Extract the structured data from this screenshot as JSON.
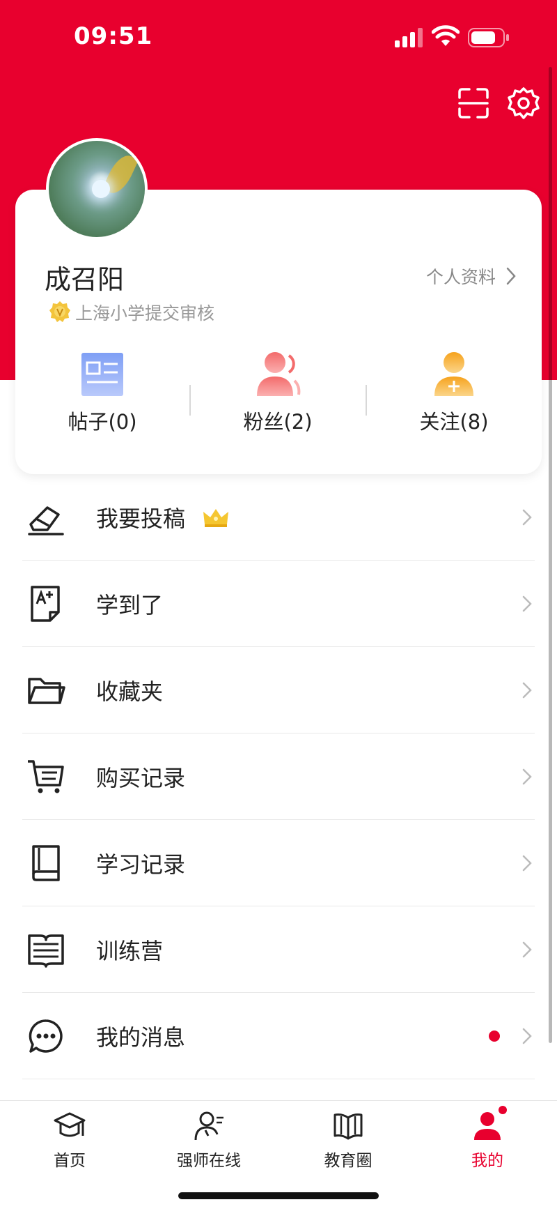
{
  "status_bar": {
    "time": "09:51"
  },
  "profile": {
    "name": "成召阳",
    "profile_link_label": "个人资料",
    "school_status": "上海小学提交审核",
    "stats": [
      {
        "label": "帖子(0)",
        "icon": "post-icon"
      },
      {
        "label": "粉丝(2)",
        "icon": "fans-icon"
      },
      {
        "label": "关注(8)",
        "icon": "follow-icon"
      }
    ]
  },
  "menu": {
    "items": [
      {
        "label": "我要投稿",
        "icon": "edit-icon",
        "badge_icon": "crown-icon"
      },
      {
        "label": "学到了",
        "icon": "grade-doc-icon"
      },
      {
        "label": "收藏夹",
        "icon": "folder-icon"
      },
      {
        "label": "购买记录",
        "icon": "cart-icon"
      },
      {
        "label": "学习记录",
        "icon": "book-icon"
      },
      {
        "label": "训练营",
        "icon": "list-doc-icon"
      },
      {
        "label": "我的消息",
        "icon": "chat-icon",
        "has_unread": true
      }
    ]
  },
  "tabbar": {
    "tabs": [
      {
        "label": "首页",
        "icon": "graduation-cap-icon"
      },
      {
        "label": "强师在线",
        "icon": "teacher-icon"
      },
      {
        "label": "教育圈",
        "icon": "open-book-icon"
      },
      {
        "label": "我的",
        "icon": "user-icon",
        "active": true
      }
    ]
  },
  "colors": {
    "brand_red": "#e8002e",
    "text": "#222222",
    "muted": "#888888"
  }
}
